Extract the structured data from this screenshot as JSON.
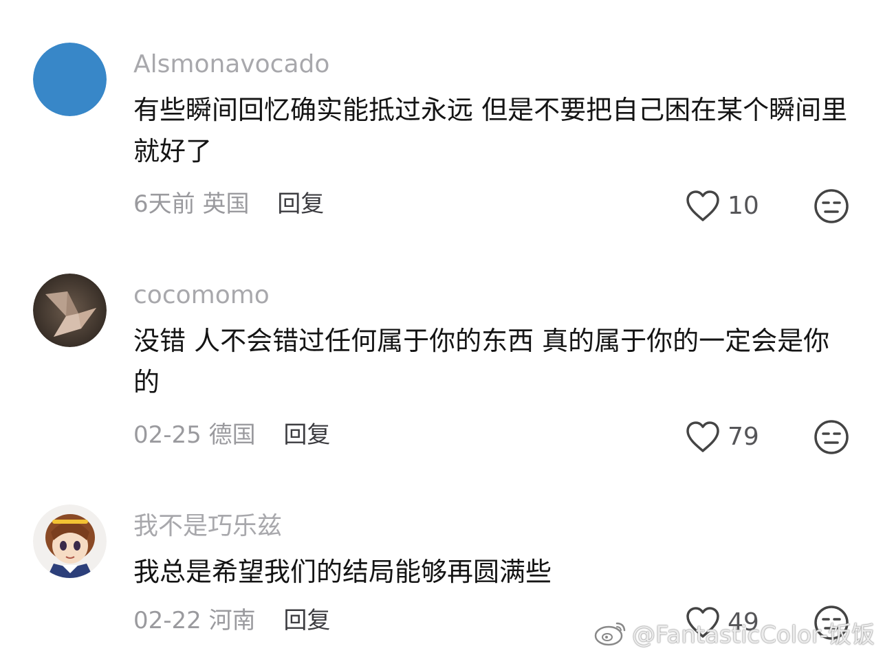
{
  "comments": [
    {
      "username": "Alsmonavocado",
      "text": "有些瞬间回忆确实能抵过永远 但是不要把自己困在某个瞬间里就好了",
      "time": "6天前",
      "location": "英国",
      "reply_label": "回复",
      "likes": "10",
      "avatar_icon": "solid-blue-avatar"
    },
    {
      "username": "cocomomo",
      "text": "没错 人不会错过任何属于你的东西 真的属于你的一定会是你的",
      "time": "02-25",
      "location": "德国",
      "reply_label": "回复",
      "likes": "79",
      "avatar_icon": "paper-crane-avatar"
    },
    {
      "username": "我不是巧乐兹",
      "text": "我总是希望我们的结局能够再圆满些",
      "time": "02-22",
      "location": "河南",
      "reply_label": "回复",
      "likes": "49",
      "avatar_icon": "anime-girl-avatar"
    }
  ],
  "watermark": {
    "text": "@FantasticColor-饭饭",
    "icon": "weibo-logo"
  },
  "colors": {
    "username": "#a8a8ac",
    "content": "#141414",
    "meta": "#9a9a9e",
    "reply": "#3c3c40",
    "avatar_blue": "#3887c8"
  }
}
